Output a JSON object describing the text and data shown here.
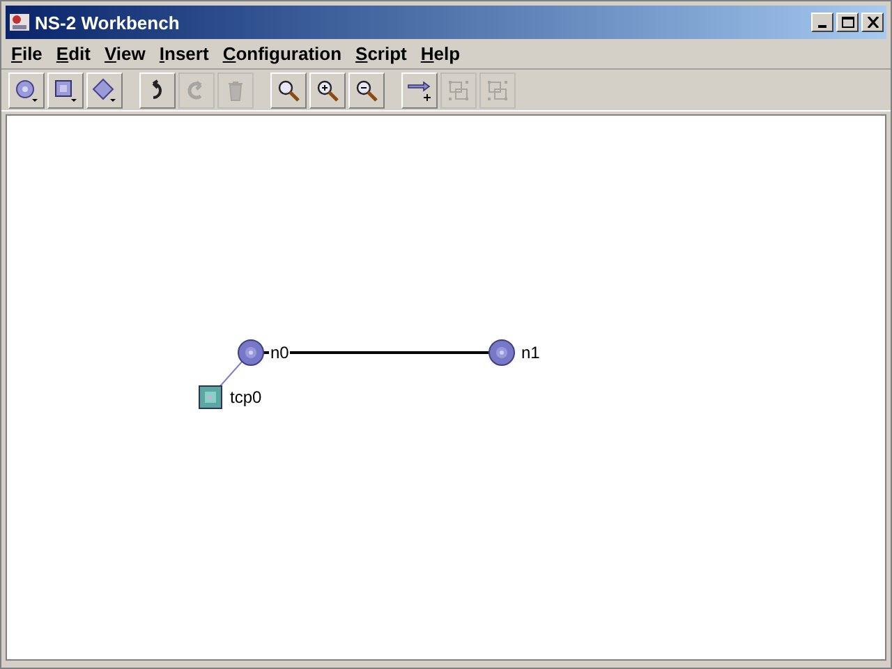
{
  "window": {
    "title": "NS-2 Workbench"
  },
  "menu": [
    "File",
    "Edit",
    "View",
    "Insert",
    "Configuration",
    "Script",
    "Help"
  ],
  "toolbar": [
    {
      "kind": "node",
      "disabled": false
    },
    {
      "kind": "agent",
      "disabled": false
    },
    {
      "kind": "app",
      "disabled": false
    },
    {
      "kind": "undo",
      "disabled": false
    },
    {
      "kind": "redo",
      "disabled": true
    },
    {
      "kind": "delete",
      "disabled": true
    },
    {
      "kind": "zoom",
      "disabled": false
    },
    {
      "kind": "zoom-in",
      "disabled": false
    },
    {
      "kind": "zoom-out",
      "disabled": false
    },
    {
      "kind": "link",
      "disabled": false
    },
    {
      "kind": "group",
      "disabled": true
    },
    {
      "kind": "ungroup",
      "disabled": true
    }
  ],
  "canvas": {
    "nodes": [
      {
        "kind": "node",
        "label": "n0"
      },
      {
        "kind": "node",
        "label": "n1"
      },
      {
        "kind": "agent",
        "label": "tcp0"
      }
    ],
    "links": [
      {
        "kind": "duplex"
      },
      {
        "kind": "attach"
      }
    ]
  }
}
